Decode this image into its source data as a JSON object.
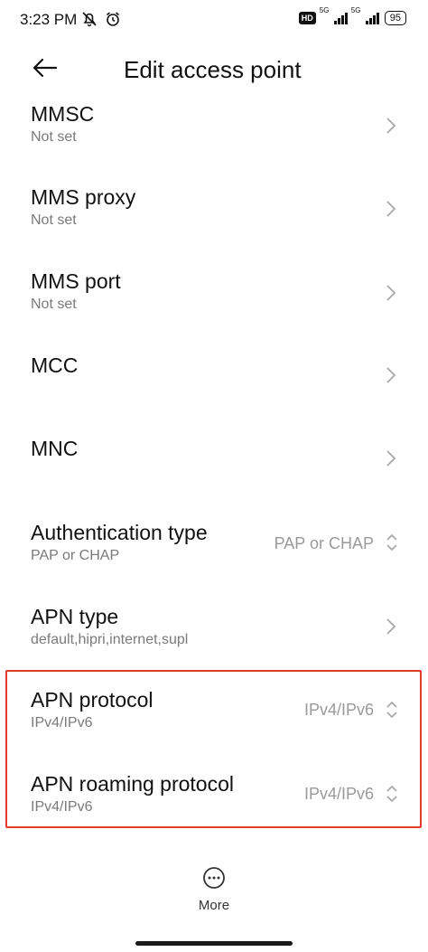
{
  "status_bar": {
    "time": "3:23 PM",
    "hd_label": "HD",
    "signal1_tag": "5G",
    "signal2_tag": "5G",
    "battery": "95"
  },
  "header": {
    "title": "Edit access point"
  },
  "rows": [
    {
      "label": "MMSC",
      "sub": "Not set",
      "control": "chevron"
    },
    {
      "label": "MMS proxy",
      "sub": "Not set",
      "control": "chevron"
    },
    {
      "label": "MMS port",
      "sub": "Not set",
      "control": "chevron"
    },
    {
      "label": "MCC",
      "sub": "",
      "control": "chevron"
    },
    {
      "label": "MNC",
      "sub": "",
      "control": "chevron"
    },
    {
      "label": "Authentication type",
      "sub": "PAP or CHAP",
      "value": "PAP or CHAP",
      "control": "select"
    },
    {
      "label": "APN type",
      "sub": "default,hipri,internet,supl",
      "control": "chevron"
    },
    {
      "label": "APN protocol",
      "sub": "IPv4/IPv6",
      "value": "IPv4/IPv6",
      "control": "select"
    },
    {
      "label": "APN roaming protocol",
      "sub": "IPv4/IPv6",
      "value": "IPv4/IPv6",
      "control": "select"
    }
  ],
  "footer": {
    "more_label": "More"
  },
  "colors": {
    "highlight": "#e53a2e",
    "secondary_text": "#7a7a7a"
  }
}
